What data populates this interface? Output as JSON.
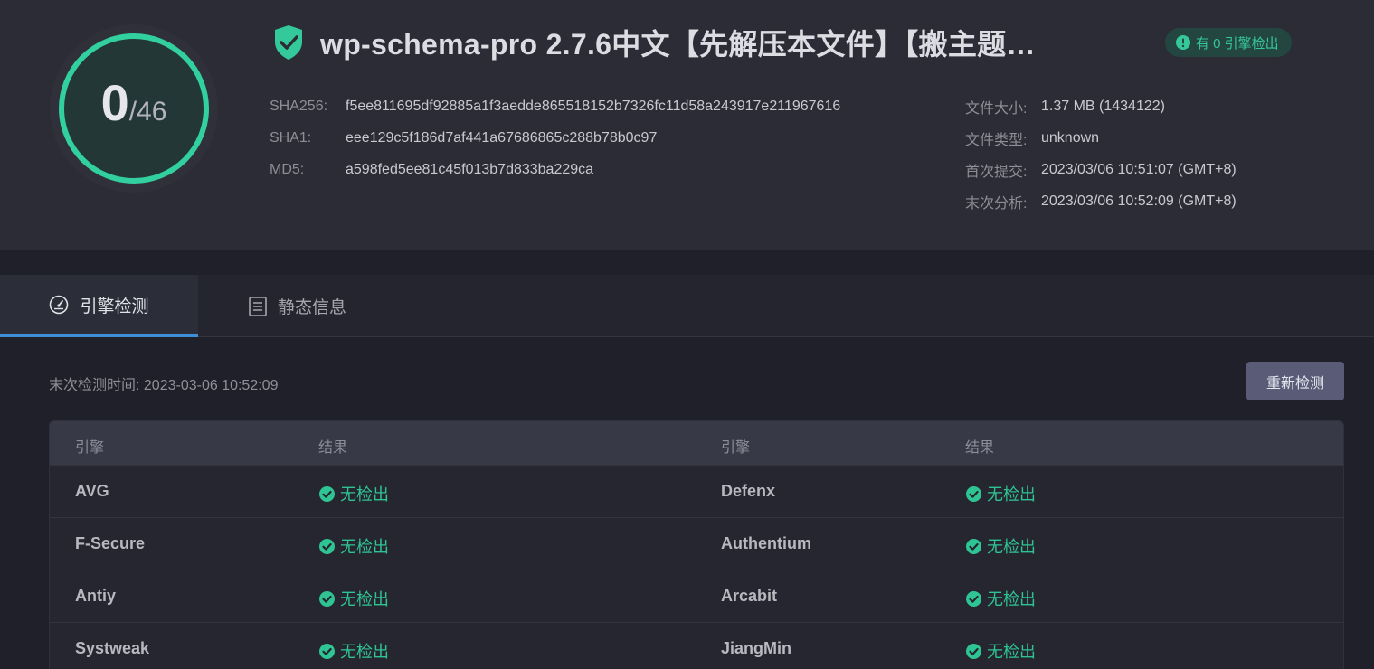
{
  "score": {
    "detected": "0",
    "total": "/46"
  },
  "file": {
    "title": "wp-schema-pro 2.7.6中文【先解压本文件】【搬主题…",
    "badge": "有 0 引擎检出"
  },
  "hashes": [
    {
      "label": "SHA256:",
      "value": "f5ee811695df92885a1f3aedde865518152b7326fc11d58a243917e211967616"
    },
    {
      "label": "SHA1:",
      "value": "eee129c5f186d7af441a67686865c288b78b0c97"
    },
    {
      "label": "MD5:",
      "value": "a598fed5ee81c45f013b7d833ba229ca"
    }
  ],
  "meta": [
    {
      "label": "文件大小:",
      "value": "1.37 MB (1434122)"
    },
    {
      "label": "文件类型:",
      "value": "unknown"
    },
    {
      "label": "首次提交:",
      "value": "2023/03/06 10:51:07 (GMT+8)"
    },
    {
      "label": "末次分析:",
      "value": "2023/03/06 10:52:09 (GMT+8)"
    }
  ],
  "tabs": {
    "engine": "引擎检测",
    "static": "静态信息"
  },
  "content": {
    "last_time": "末次检测时间: 2023-03-06 10:52:09",
    "rescan": "重新检测"
  },
  "table": {
    "headers": {
      "engine": "引擎",
      "result": "结果"
    },
    "rows": [
      {
        "left": {
          "engine": "AVG",
          "result": "无检出"
        },
        "right": {
          "engine": "Defenx",
          "result": "无检出"
        }
      },
      {
        "left": {
          "engine": "F-Secure",
          "result": "无检出"
        },
        "right": {
          "engine": "Authentium",
          "result": "无检出"
        }
      },
      {
        "left": {
          "engine": "Antiy",
          "result": "无检出"
        },
        "right": {
          "engine": "Arcabit",
          "result": "无检出"
        }
      },
      {
        "left": {
          "engine": "Systweak",
          "result": "无检出"
        },
        "right": {
          "engine": "JiangMin",
          "result": "无检出"
        }
      }
    ]
  },
  "colors": {
    "accent": "#35c99a",
    "tab_underline": "#3c8fd8",
    "button": "#5a5c77"
  },
  "icons": {
    "title": "shield-check-icon",
    "badge": "alert-icon",
    "tab_engine": "gauge-icon",
    "tab_static": "list-icon",
    "result": "check-circle-icon"
  }
}
